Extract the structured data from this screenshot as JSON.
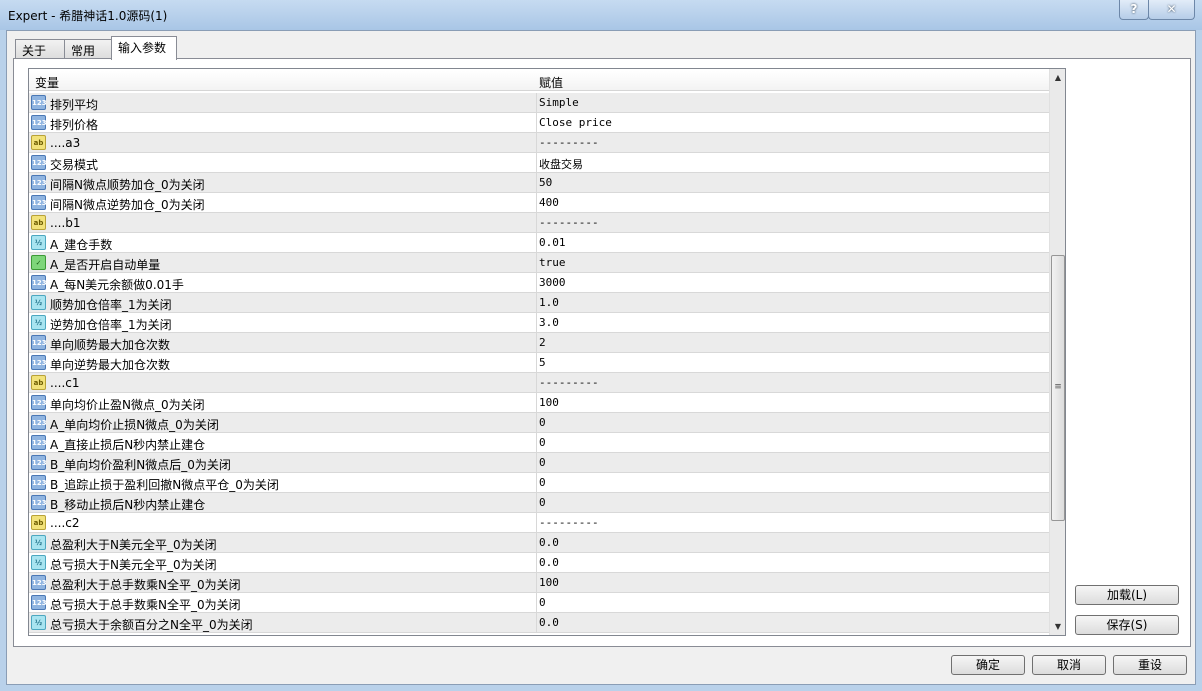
{
  "window": {
    "title": "Expert - 希腊神话1.0源码(1)",
    "help": "?",
    "close": "✕"
  },
  "tabs": [
    "关于",
    "常用",
    "输入参数"
  ],
  "columns": {
    "variable": "变量",
    "value": "赋值"
  },
  "rows": [
    {
      "type": "int",
      "name": "排列平均",
      "value": "Simple"
    },
    {
      "type": "int",
      "name": "排列价格",
      "value": "Close price"
    },
    {
      "type": "str",
      "name": "....a3",
      "value": "---------"
    },
    {
      "type": "int",
      "name": "交易模式",
      "value": "收盘交易"
    },
    {
      "type": "int",
      "name": "间隔N微点顺势加仓_0为关闭",
      "value": "50"
    },
    {
      "type": "int",
      "name": "间隔N微点逆势加仓_0为关闭",
      "value": "400"
    },
    {
      "type": "str",
      "name": "....b1",
      "value": "---------"
    },
    {
      "type": "dbl",
      "name": "A_建仓手数",
      "value": "0.01"
    },
    {
      "type": "bool",
      "name": "A_是否开启自动单量",
      "value": "true"
    },
    {
      "type": "int",
      "name": "A_每N美元余额做0.01手",
      "value": "3000"
    },
    {
      "type": "dbl",
      "name": "顺势加仓倍率_1为关闭",
      "value": "1.0"
    },
    {
      "type": "dbl",
      "name": "逆势加仓倍率_1为关闭",
      "value": "3.0"
    },
    {
      "type": "int",
      "name": "单向顺势最大加仓次数",
      "value": "2"
    },
    {
      "type": "int",
      "name": "单向逆势最大加仓次数",
      "value": "5"
    },
    {
      "type": "str",
      "name": "....c1",
      "value": "---------"
    },
    {
      "type": "int",
      "name": "单向均价止盈N微点_0为关闭",
      "value": "100"
    },
    {
      "type": "int",
      "name": "A_单向均价止损N微点_0为关闭",
      "value": "0"
    },
    {
      "type": "int",
      "name": "A_直接止损后N秒内禁止建仓",
      "value": "0"
    },
    {
      "type": "int",
      "name": "B_单向均价盈利N微点后_0为关闭",
      "value": "0"
    },
    {
      "type": "int",
      "name": "B_追踪止损于盈利回撤N微点平仓_0为关闭",
      "value": "0"
    },
    {
      "type": "int",
      "name": "B_移动止损后N秒内禁止建仓",
      "value": "0"
    },
    {
      "type": "str",
      "name": "....c2",
      "value": "---------"
    },
    {
      "type": "dbl",
      "name": "总盈利大于N美元全平_0为关闭",
      "value": "0.0"
    },
    {
      "type": "dbl",
      "name": "总亏损大于N美元全平_0为关闭",
      "value": "0.0"
    },
    {
      "type": "int",
      "name": "总盈利大于总手数乘N全平_0为关闭",
      "value": "100"
    },
    {
      "type": "int",
      "name": "总亏损大于总手数乘N全平_0为关闭",
      "value": "0"
    },
    {
      "type": "dbl",
      "name": "总亏损大于余额百分之N全平_0为关闭",
      "value": "0.0"
    }
  ],
  "icon_labels": {
    "int": "123",
    "str": "ab",
    "dbl": "½",
    "bool": "✓"
  },
  "buttons": {
    "load": "加载(L)",
    "save": "保存(S)",
    "ok": "确定",
    "cancel": "取消",
    "reset": "重设"
  }
}
